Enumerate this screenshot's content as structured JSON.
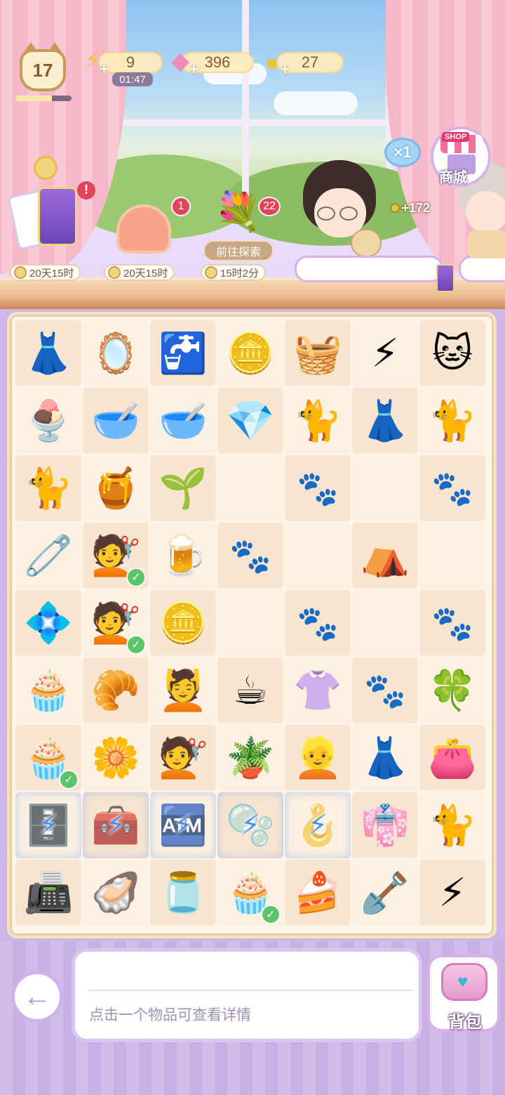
{
  "hud": {
    "level": "17",
    "level_progress": 0.65,
    "energy": "9",
    "energy_timer": "01:47",
    "gems": "396",
    "coins": "27"
  },
  "shelf": {
    "card_pack_time": "20天15时",
    "cake_badge": "1",
    "cake_time": "20天15时",
    "flower_badge": "22",
    "explore_label": "前往探索",
    "flower_time": "15时2分"
  },
  "right_side": {
    "multiplier": "×1",
    "shop_tag": "SHOP",
    "shop_label": "商城",
    "coin_reward": "+172"
  },
  "grid": {
    "rows": [
      [
        {
          "icon": "gothic-dress",
          "g": "👗"
        },
        {
          "icon": "pink-mirror",
          "g": "🪞"
        },
        {
          "icon": "water-dispenser",
          "g": "🚰"
        },
        {
          "icon": "gold-coins",
          "g": "🪙"
        },
        {
          "icon": "towel-rack",
          "g": "🧺"
        },
        {
          "icon": "double-energy",
          "g": "⚡"
        },
        {
          "icon": "calico-cat",
          "g": "🐱"
        }
      ],
      [
        {
          "icon": "tiramisu-cup",
          "g": "🍨"
        },
        {
          "icon": "pink-pet-bowl",
          "g": "🥣"
        },
        {
          "icon": "pink-pet-bowl-full",
          "g": "🥣"
        },
        {
          "icon": "pink-gem",
          "g": "💎"
        },
        {
          "icon": "lucky-cat",
          "g": "🐈"
        },
        {
          "icon": "white-dress",
          "g": "👗"
        },
        {
          "icon": "siamese-cat",
          "g": "🐈"
        }
      ],
      [
        {
          "icon": "brown-cat",
          "g": "🐈"
        },
        {
          "icon": "orange-juice-jar",
          "g": "🍯"
        },
        {
          "icon": "sprout",
          "g": "🌱"
        },
        {
          "empty": true
        },
        {
          "empty": true,
          "paw": true
        },
        {
          "empty": true
        },
        {
          "empty": true,
          "paw": true
        }
      ],
      [
        {
          "icon": "hanger",
          "g": "🧷"
        },
        {
          "icon": "bun-hairstyle",
          "g": "💇",
          "check": true
        },
        {
          "icon": "juice-cup",
          "g": "🍺"
        },
        {
          "empty": true,
          "paw": true
        },
        {
          "empty": true
        },
        {
          "icon": "cat-tent",
          "g": "⛺"
        },
        {
          "empty": true
        }
      ],
      [
        {
          "icon": "earrings",
          "g": "💠"
        },
        {
          "icon": "bun-hairstyle-2",
          "g": "💇",
          "check": true
        },
        {
          "icon": "gold-coin",
          "g": "🪙"
        },
        {
          "empty": true
        },
        {
          "empty": true,
          "paw": true
        },
        {
          "empty": true
        },
        {
          "empty": true,
          "paw": true
        }
      ],
      [
        {
          "icon": "fruit-cupcake",
          "g": "🧁"
        },
        {
          "icon": "flour-pile",
          "g": "🥐"
        },
        {
          "icon": "curly-hairstyle",
          "g": "💆"
        },
        {
          "icon": "coffee-cup",
          "g": "☕"
        },
        {
          "icon": "maid-outfit",
          "g": "👚"
        },
        {
          "empty": true,
          "paw": true
        },
        {
          "icon": "green-clover",
          "g": "🍀"
        }
      ],
      [
        {
          "icon": "strawberry-cupcake",
          "g": "🧁",
          "check": true
        },
        {
          "icon": "ginkgo-cluster",
          "g": "🌼"
        },
        {
          "icon": "white-hairstyle",
          "g": "💇"
        },
        {
          "icon": "leafy-plant",
          "g": "🪴"
        },
        {
          "icon": "blonde-hairstyle",
          "g": "👱"
        },
        {
          "icon": "yellow-dress",
          "g": "👗"
        },
        {
          "icon": "pink-bag",
          "g": "👛"
        }
      ],
      [
        {
          "icon": "flower-cabinet",
          "g": "🗄️",
          "locked": true
        },
        {
          "icon": "jewelry-box",
          "g": "🧰",
          "locked": true
        },
        {
          "icon": "vending-machine",
          "g": "🏧",
          "locked": true
        },
        {
          "icon": "fish-bowl",
          "g": "🫧",
          "locked": true
        },
        {
          "icon": "clothes-rack",
          "g": "🪝",
          "locked": true
        },
        {
          "icon": "pink-dress",
          "g": "👘"
        },
        {
          "icon": "white-cat",
          "g": "🐈"
        }
      ],
      [
        {
          "icon": "cash-register",
          "g": "📠"
        },
        {
          "icon": "pearl-shell",
          "g": "🦪"
        },
        {
          "icon": "berry-jar",
          "g": "🫙"
        },
        {
          "icon": "strawberry-cupcake-2",
          "g": "🧁",
          "check": true
        },
        {
          "icon": "matcha-cake",
          "g": "🍰"
        },
        {
          "icon": "shovel",
          "g": "🪏"
        },
        {
          "icon": "energy-bolt",
          "g": "⚡"
        }
      ]
    ]
  },
  "bottom": {
    "hint": "点击一个物品可查看详情",
    "bag_label": "背包"
  }
}
